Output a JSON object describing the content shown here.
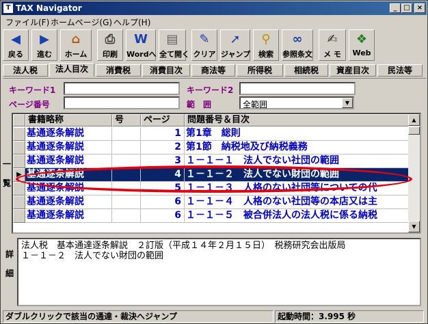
{
  "window": {
    "title": "TAX Navigator",
    "icon_text": "T"
  },
  "title_buttons": [
    {
      "icon": "minimize-icon",
      "glyph": "_"
    },
    {
      "icon": "maximize-icon",
      "glyph": "□"
    },
    {
      "icon": "close-icon",
      "glyph": "×"
    }
  ],
  "menu": [
    "ファイル(F)",
    "ホームページ(G)",
    "ヘルプ(H)"
  ],
  "toolbar": [
    {
      "label": "戻る",
      "icon": "back-icon",
      "glyph": "◀",
      "color": "#1a3fb0"
    },
    {
      "label": "進む",
      "icon": "forward-icon",
      "glyph": "▶",
      "color": "#1a3fb0"
    },
    {
      "label": "ホーム",
      "icon": "home-icon",
      "glyph": "⌂",
      "color": "#b06010"
    },
    {
      "label": "印刷",
      "icon": "print-icon",
      "glyph": "⎙",
      "color": "#404040"
    },
    {
      "label": "Wordへ",
      "icon": "word-icon",
      "glyph": "W",
      "color": "#1a3fb0"
    },
    {
      "label": "全て開く",
      "icon": "open-all-icon",
      "glyph": "▤",
      "color": "#606060"
    },
    {
      "label": "クリア",
      "icon": "clear-icon",
      "glyph": "✎",
      "color": "#1a3fb0"
    },
    {
      "label": "ジャンプ",
      "icon": "jump-icon",
      "glyph": "➚",
      "color": "#1a3fb0"
    },
    {
      "label": "検索",
      "icon": "search-icon",
      "glyph": "⚲",
      "color": "#c09000"
    },
    {
      "label": "参照条文",
      "icon": "reference-icon",
      "glyph": "∞",
      "color": "#1a3fb0"
    },
    {
      "label": "メ モ",
      "icon": "memo-icon",
      "glyph": "✍",
      "color": "#303030"
    },
    {
      "label": "Web",
      "icon": "web-icon",
      "glyph": "❖",
      "color": "#208020"
    }
  ],
  "tabs": [
    "法人税",
    "法人目次",
    "消費税",
    "消費目次",
    "商法等",
    "所得税",
    "相続税",
    "資産目次",
    "民法等"
  ],
  "active_tab": 1,
  "search": {
    "keyword1_label": "キーワード1",
    "keyword1_value": "",
    "keyword2_label": "キーワード2",
    "keyword2_value": "",
    "page_label": "ページ番号",
    "page_value": "",
    "scope_label": "範　囲",
    "scope_value": "全範囲"
  },
  "side_labels": {
    "list": "一\n\n覧",
    "detail": "詳\n\n細"
  },
  "grid": {
    "columns": [
      "書籍略称",
      "号",
      "ページ",
      "問題番号＆目次"
    ],
    "rows": [
      {
        "book": "基通逐条解説",
        "no": "",
        "page": "1",
        "title": "第1章　総則"
      },
      {
        "book": "基通逐条解説",
        "no": "",
        "page": "2",
        "title": "第1節　納税地及び納税義務"
      },
      {
        "book": "基通逐条解説",
        "no": "",
        "page": "3",
        "title": "１－１－１　法人でない社団の範囲"
      },
      {
        "book": "基通逐条解説",
        "no": "",
        "page": "4",
        "title": "１－１－２　法人でない財団の範囲"
      },
      {
        "book": "基通逐条解説",
        "no": "",
        "page": "5",
        "title": "１－１－３　人格のない社団等についての代"
      },
      {
        "book": "基通逐条解説",
        "no": "",
        "page": "6",
        "title": "１－１－４　人格のない社団等の本店又は主"
      },
      {
        "book": "基通逐条解説",
        "no": "",
        "page": "6",
        "title": "１－１－５　被合併法人の法人税に係る納税"
      }
    ],
    "selected_row": 3
  },
  "detail": {
    "line1": "法人税　基本通達逐条解説　２訂版（平成１４年２月１５日）　税務研究会出版局",
    "line2": "１－１－２　法人でない財団の範囲"
  },
  "status": {
    "message": "ダブルクリックで該当の通達・裁決へジャンプ",
    "startup_label": "起動時間：",
    "startup_value": "3.995 秒"
  },
  "colors": {
    "title_bar": "#0a246a",
    "label_purple": "#800080",
    "link_blue": "#0000c0",
    "highlight": "#e00010"
  }
}
